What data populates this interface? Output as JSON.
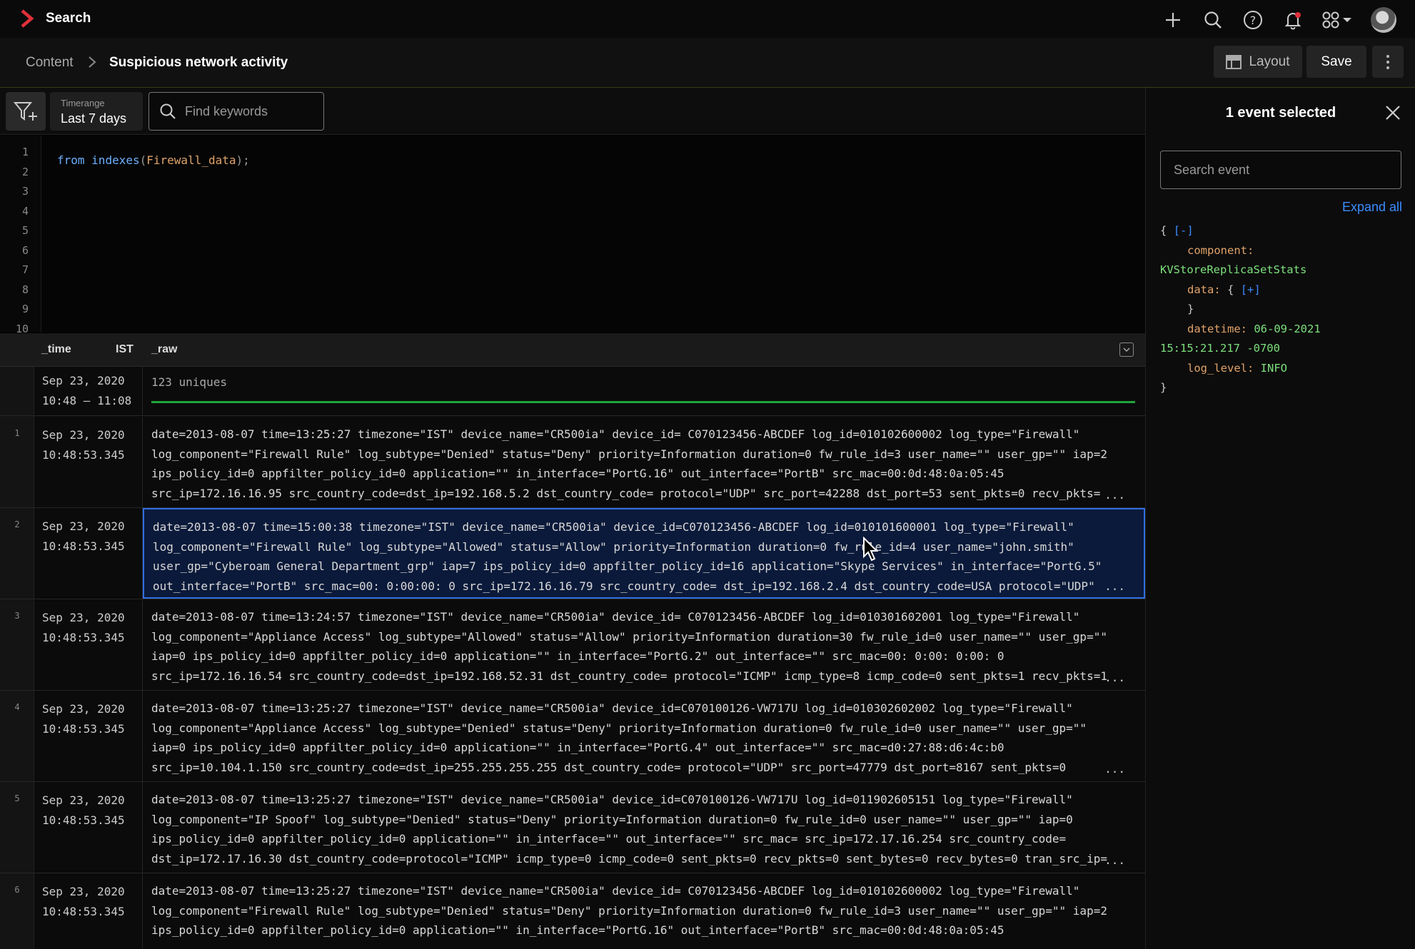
{
  "header": {
    "app_title": "Search",
    "accent": "#e0303a",
    "icons": [
      "plus-icon",
      "search-icon",
      "help-icon",
      "bell-icon",
      "apps-icon",
      "avatar"
    ]
  },
  "breadcrumb": {
    "root": "Content",
    "current": "Suspicious network activity"
  },
  "toolbar": {
    "layout_label": "Layout",
    "save_label": "Save"
  },
  "filters": {
    "timerange_label": "Timerange",
    "timerange_value": "Last 7 days",
    "keyword_placeholder": "Find keywords"
  },
  "editor": {
    "line_numbers": [
      "1",
      "2",
      "3",
      "4",
      "5",
      "6",
      "7",
      "8",
      "9",
      "10"
    ],
    "code": {
      "keyword": "from",
      "function": "indexes",
      "open": "(",
      "argument": "Firewall_data",
      "close": ");"
    }
  },
  "table": {
    "columns": {
      "time": "_time",
      "tz": "IST",
      "raw": "_raw"
    },
    "summary": {
      "date": "Sep 23, 2020",
      "range": "10:48 – 11:08",
      "text": "123 uniques"
    },
    "rows": [
      {
        "num": "1",
        "date": "Sep 23, 2020",
        "time": "10:48:53.345",
        "raw": "date=2013-08-07 time=13:25:27 timezone=\"IST\" device_name=\"CR500ia\" device_id= C070123456-ABCDEF log_id=010102600002 log_type=\"Firewall\"\nlog_component=\"Firewall Rule\" log_subtype=\"Denied\" status=\"Deny\" priority=Information duration=0 fw_rule_id=3 user_name=\"\" user_gp=\"\" iap=2\nips_policy_id=0 appfilter_policy_id=0 application=\"\" in_interface=\"PortG.16\" out_interface=\"PortB\" src_mac=00:0d:48:0a:05:45\nsrc_ip=172.16.16.95 src_country_code=dst_ip=192.168.5.2 dst_country_code= protocol=\"UDP\" src_port=42288 dst_port=53 sent_pkts=0 recv_pkts="
      },
      {
        "num": "2",
        "date": "Sep 23, 2020",
        "time": "10:48:53.345",
        "raw": "date=2013-08-07 time=15:00:38 timezone=\"IST\" device_name=\"CR500ia\" device_id=C070123456-ABCDEF log_id=010101600001 log_type=\"Firewall\"\nlog_component=\"Firewall Rule\" log_subtype=\"Allowed\" status=\"Allow\" priority=Information duration=0 fw_rule_id=4 user_name=\"john.smith\"\nuser_gp=\"Cyberoam General Department_grp\" iap=7 ips_policy_id=0 appfilter_policy_id=16 application=\"Skype Services\" in_interface=\"PortG.5\"\nout_interface=\"PortB\" src_mac=00: 0:00:00: 0 src_ip=172.16.16.79 src_country_code= dst_ip=192.168.2.4 dst_country_code=USA protocol=\"UDP\""
      },
      {
        "num": "3",
        "date": "Sep 23, 2020",
        "time": "10:48:53.345",
        "raw": "date=2013-08-07 time=13:24:57 timezone=\"IST\" device_name=\"CR500ia\" device_id= C070123456-ABCDEF log_id=010301602001 log_type=\"Firewall\"\nlog_component=\"Appliance Access\" log_subtype=\"Allowed\" status=\"Allow\" priority=Information duration=30 fw_rule_id=0 user_name=\"\" user_gp=\"\"\niap=0 ips_policy_id=0 appfilter_policy_id=0 application=\"\" in_interface=\"PortG.2\" out_interface=\"\" src_mac=00: 0:00: 0:00: 0\nsrc_ip=172.16.16.54 src_country_code=dst_ip=192.168.52.31 dst_country_code= protocol=\"ICMP\" icmp_type=8 icmp_code=0 sent_pkts=1 recv_pkts=1"
      },
      {
        "num": "4",
        "date": "Sep 23, 2020",
        "time": "10:48:53.345",
        "raw": "date=2013-08-07 time=13:25:27 timezone=\"IST\" device_name=\"CR500ia\" device_id=C070100126-VW717U log_id=010302602002 log_type=\"Firewall\"\nlog_component=\"Appliance Access\" log_subtype=\"Denied\" status=\"Deny\" priority=Information duration=0 fw_rule_id=0 user_name=\"\" user_gp=\"\"\niap=0 ips_policy_id=0 appfilter_policy_id=0 application=\"\" in_interface=\"PortG.4\" out_interface=\"\" src_mac=d0:27:88:d6:4c:b0\nsrc_ip=10.104.1.150 src_country_code=dst_ip=255.255.255.255 dst_country_code= protocol=\"UDP\" src_port=47779 dst_port=8167 sent_pkts=0"
      },
      {
        "num": "5",
        "date": "Sep 23, 2020",
        "time": "10:48:53.345",
        "raw": "date=2013-08-07 time=13:25:27 timezone=\"IST\" device_name=\"CR500ia\" device_id=C070100126-VW717U log_id=011902605151 log_type=\"Firewall\"\nlog_component=\"IP Spoof\" log_subtype=\"Denied\" status=\"Deny\" priority=Information duration=0 fw_rule_id=0 user_name=\"\" user_gp=\"\" iap=0\nips_policy_id=0 appfilter_policy_id=0 application=\"\" in_interface=\"\" out_interface=\"\" src_mac= src_ip=172.17.16.254 src_country_code=\ndst_ip=172.17.16.30 dst_country_code=protocol=\"ICMP\" icmp_type=0 icmp_code=0 sent_pkts=0 recv_pkts=0 sent_bytes=0 recv_bytes=0 tran_src_ip="
      },
      {
        "num": "6",
        "date": "Sep 23, 2020",
        "time": "10:48:53.345",
        "raw": "date=2013-08-07 time=13:25:27 timezone=\"IST\" device_name=\"CR500ia\" device_id= C070123456-ABCDEF log_id=010102600002 log_type=\"Firewall\"\nlog_component=\"Firewall Rule\" log_subtype=\"Denied\" status=\"Deny\" priority=Information duration=0 fw_rule_id=3 user_name=\"\" user_gp=\"\" iap=2\nips_policy_id=0 appfilter_policy_id=0 application=\"\" in_interface=\"PortG.16\" out_interface=\"PortB\" src_mac=00:0d:48:0a:05:45"
      }
    ],
    "ellipsis": "..."
  },
  "panel": {
    "title": "1 event selected",
    "search_placeholder": "Search event",
    "expand_all": "Expand all",
    "json": {
      "open": "{",
      "collapse_toggle": "[-]",
      "component_key": "component:",
      "component_val": "KVStoreReplicaSetStats",
      "data_key": "data:",
      "data_open": "{",
      "expand_toggle": "[+]",
      "data_close": "}",
      "datetime_key": "datetime:",
      "datetime_val_1": "06-09-2021",
      "datetime_val_2": "15:15:21.217 -0700",
      "log_level_key": "log_level:",
      "log_level_val": "INFO",
      "close": "}"
    }
  }
}
